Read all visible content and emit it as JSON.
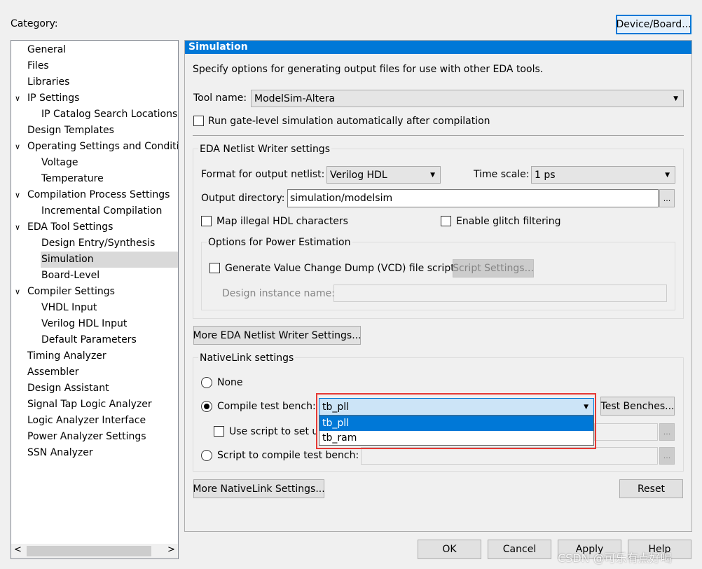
{
  "category_label": "Category:",
  "device_board_button": "Device/Board...",
  "tree": {
    "items": [
      {
        "label": "General",
        "level": 0,
        "expander": ""
      },
      {
        "label": "Files",
        "level": 0,
        "expander": ""
      },
      {
        "label": "Libraries",
        "level": 0,
        "expander": ""
      },
      {
        "label": "IP Settings",
        "level": 0,
        "expander": "expanded"
      },
      {
        "label": "IP Catalog Search Locations",
        "level": 1,
        "expander": ""
      },
      {
        "label": "Design Templates",
        "level": 0,
        "expander": ""
      },
      {
        "label": "Operating Settings and Conditions",
        "level": 0,
        "expander": "expanded"
      },
      {
        "label": "Voltage",
        "level": 1,
        "expander": ""
      },
      {
        "label": "Temperature",
        "level": 1,
        "expander": ""
      },
      {
        "label": "Compilation Process Settings",
        "level": 0,
        "expander": "expanded"
      },
      {
        "label": "Incremental Compilation",
        "level": 1,
        "expander": ""
      },
      {
        "label": "EDA Tool Settings",
        "level": 0,
        "expander": "expanded"
      },
      {
        "label": "Design Entry/Synthesis",
        "level": 1,
        "expander": ""
      },
      {
        "label": "Simulation",
        "level": 1,
        "expander": "",
        "selected": true
      },
      {
        "label": "Board-Level",
        "level": 1,
        "expander": ""
      },
      {
        "label": "Compiler Settings",
        "level": 0,
        "expander": "expanded"
      },
      {
        "label": "VHDL Input",
        "level": 1,
        "expander": ""
      },
      {
        "label": "Verilog HDL Input",
        "level": 1,
        "expander": ""
      },
      {
        "label": "Default Parameters",
        "level": 1,
        "expander": ""
      },
      {
        "label": "Timing Analyzer",
        "level": 0,
        "expander": ""
      },
      {
        "label": "Assembler",
        "level": 0,
        "expander": ""
      },
      {
        "label": "Design Assistant",
        "level": 0,
        "expander": ""
      },
      {
        "label": "Signal Tap Logic Analyzer",
        "level": 0,
        "expander": ""
      },
      {
        "label": "Logic Analyzer Interface",
        "level": 0,
        "expander": ""
      },
      {
        "label": "Power Analyzer Settings",
        "level": 0,
        "expander": ""
      },
      {
        "label": "SSN Analyzer",
        "level": 0,
        "expander": ""
      }
    ],
    "scroll_left_glyph": "<",
    "scroll_right_glyph": ">"
  },
  "panel": {
    "title": "Simulation",
    "description": "Specify options for generating output files for use with other EDA tools.",
    "tool_name_label": "Tool name:",
    "tool_name_value": "ModelSim-Altera",
    "run_gate_level_label": "Run gate-level simulation automatically after compilation",
    "run_gate_level_checked": false
  },
  "netlist": {
    "title": "EDA Netlist Writer settings",
    "format_label": "Format for output netlist:",
    "format_value": "Verilog HDL",
    "timescale_label": "Time scale:",
    "timescale_value": "1 ps",
    "outdir_label": "Output directory:",
    "outdir_value": "simulation/modelsim",
    "browse_label": "...",
    "map_illegal_label": "Map illegal HDL characters",
    "glitch_label": "Enable glitch filtering",
    "power": {
      "title": "Options for Power Estimation",
      "vcd_label": "Generate Value Change Dump (VCD) file script",
      "script_settings_button": "Script Settings...",
      "instance_label": "Design instance name:"
    },
    "more_button": "More EDA Netlist Writer Settings..."
  },
  "nativelink": {
    "title": "NativeLink settings",
    "none_label": "None",
    "compile_tb_label": "Compile test bench:",
    "compile_tb_value": "tb_pll",
    "test_benches_button": "Test Benches...",
    "use_script_label": "Use script to set up simulation:",
    "script_compile_label": "Script to compile test bench:",
    "browse_label": "...",
    "selected_option": "compile_test_bench",
    "dropdown_options": [
      "tb_pll",
      "tb_ram"
    ],
    "dropdown_highlighted": "tb_pll",
    "more_button": "More NativeLink Settings...",
    "reset_button": "Reset"
  },
  "footer": {
    "ok": "OK",
    "cancel": "Cancel",
    "apply": "Apply",
    "help": "Help"
  },
  "watermark": "CSDN @可乐有点好喝",
  "colors": {
    "header_blue": "#0078d7",
    "selection_blue": "#0078d7",
    "combo_focus_bg": "#cce4f7",
    "annotation_red": "#e53935",
    "tree_selected_bg": "#d9d9d9"
  }
}
